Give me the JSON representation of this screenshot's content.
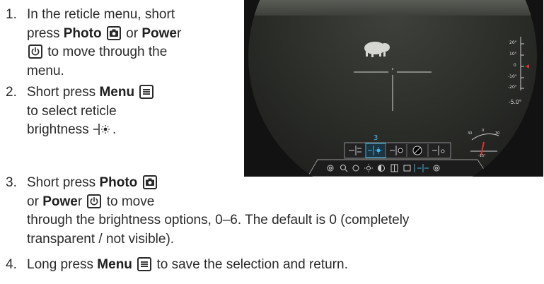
{
  "steps": [
    {
      "number": "1.",
      "lines": {
        "l1": "In the reticle menu, short",
        "l2_a": "press ",
        "l2_photo": "Photo",
        "l2_or": " or ",
        "l2_power": "Powe",
        "l2_power_r": "r",
        "l3": " to move through the",
        "l4": "menu."
      }
    },
    {
      "number": "2.",
      "lines": {
        "l1_a": "Short press ",
        "l1_menu": "Menu",
        "l2": "to select reticle",
        "l3": "brightness ",
        "l3_end": "."
      }
    },
    {
      "number": "3.",
      "lines": {
        "l1_a": "Short press ",
        "l1_photo": "Photo",
        "l2_a": "or ",
        "l2_power": "Powe",
        "l2_power_r": "r",
        "l2_end": " to move",
        "l3": "through the brightness options, 0–6. The default is 0 (completely",
        "l4": "transparent / not visible)."
      }
    },
    {
      "number": "4.",
      "lines": {
        "l1_a": "Long press ",
        "l1_menu": "Menu",
        "l1_end": " to save the selection and return."
      }
    }
  ],
  "icons": {
    "photo": "camera-button-icon",
    "power": "power-button-icon",
    "menu": "menu-button-icon",
    "brightness": "reticle-brightness-icon"
  },
  "device_screen": {
    "selected_value": "3",
    "scale_labels": [
      "20°",
      "10°",
      "0",
      "-10°",
      "-20°"
    ],
    "tilt_readout": "-5.0°",
    "compass_labels": [
      "30",
      "0",
      "30"
    ],
    "roll_readout": "-15°",
    "accent_color": "#3fb7e8",
    "indicator_color": "#e03030"
  }
}
